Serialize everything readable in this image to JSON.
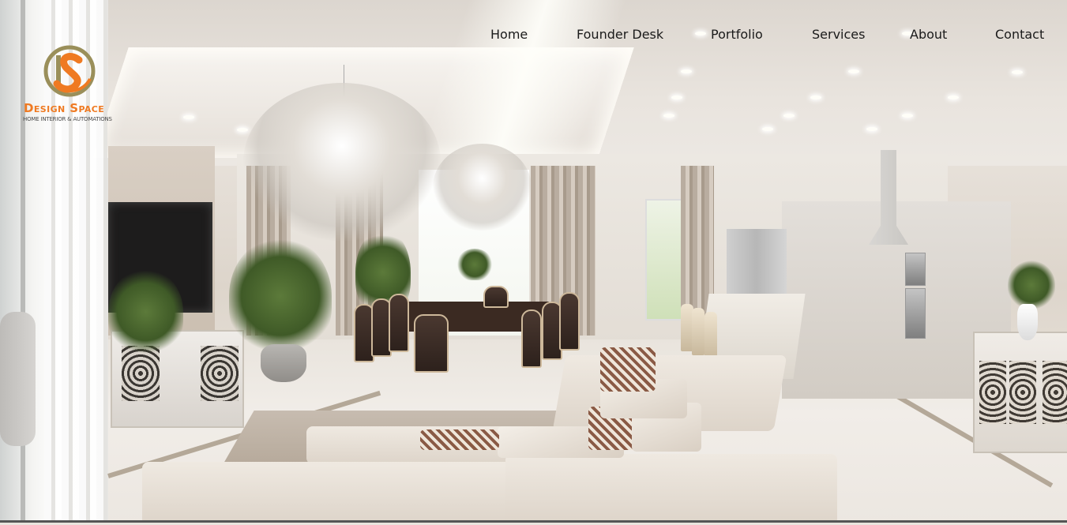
{
  "brand": {
    "name": "Design Space",
    "tagline": "HOME INTERIOR & AUTOMATIONS",
    "icon": "ds-monogram-logo",
    "colors": {
      "orange": "#ef7a22",
      "olive": "#9a8f5a",
      "tagline": "#4a4a4a"
    }
  },
  "nav": {
    "items": [
      {
        "label": "Home"
      },
      {
        "label": "Founder Desk"
      },
      {
        "label": "Portfolio"
      },
      {
        "label": "Services"
      },
      {
        "label": "About"
      },
      {
        "label": "Contact"
      }
    ],
    "text_color": "#1a1a1a"
  },
  "hero": {
    "image": "luxury-living-dining-kitchen-interior"
  }
}
